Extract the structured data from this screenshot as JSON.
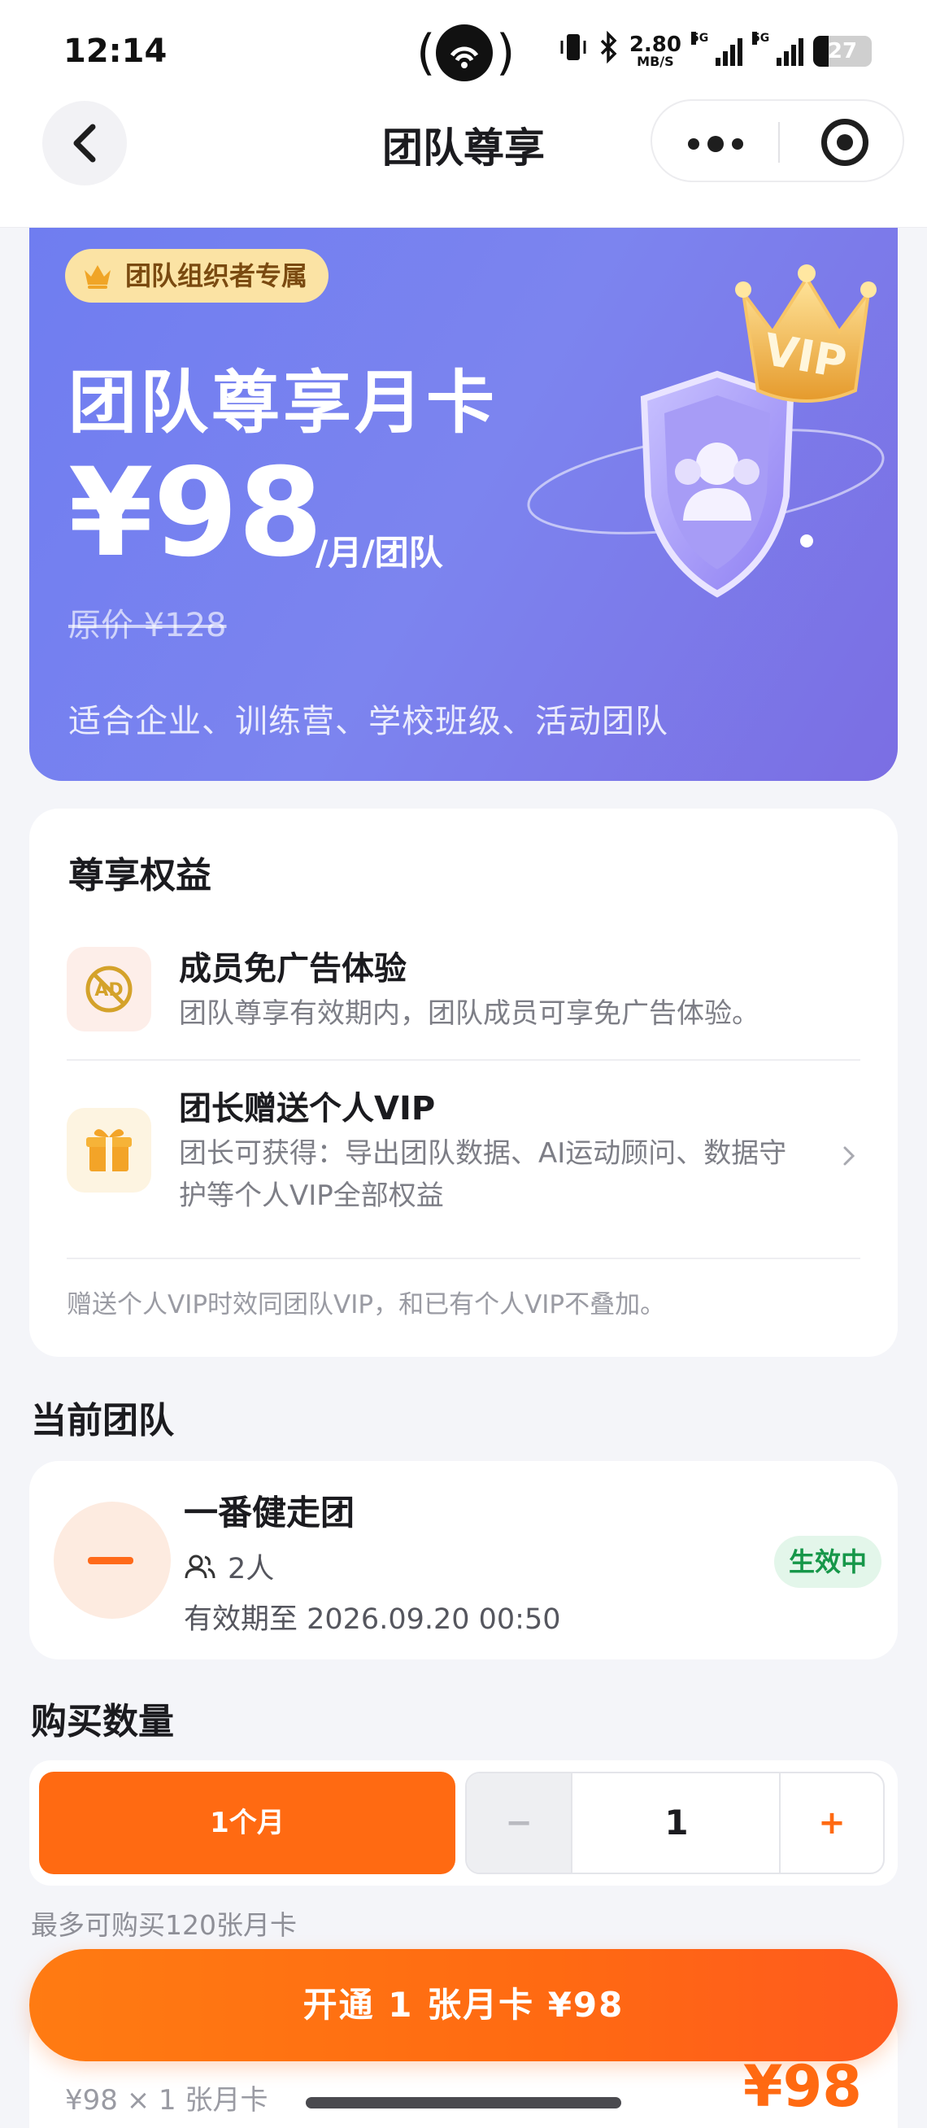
{
  "status_bar": {
    "time": "12:14",
    "net_speed_value": "2.80",
    "net_speed_unit": "MB/S",
    "signal1_label": "5G",
    "signal2_label": "5G",
    "battery_level": "27"
  },
  "header": {
    "title": "团队尊享"
  },
  "hero": {
    "badge": "团队组织者专属",
    "title": "团队尊享月卡",
    "price": "¥98",
    "price_unit": "/月/团队",
    "original_price": "原价 ¥128",
    "description": "适合企业、训练营、学校班级、活动团队",
    "art_label": "VIP"
  },
  "benefits": {
    "section_title": "尊享权益",
    "items": [
      {
        "title": "成员免广告体验",
        "desc": "团队尊享有效期内，团队成员可享免广告体验。",
        "icon": "no-ad-icon"
      },
      {
        "title": "团长赠送个人VIP",
        "desc_line1": "团长可获得：导出团队数据、AI运动顾问、数据守",
        "desc_line2": "护等个人VIP全部权益",
        "icon": "gift-icon"
      }
    ],
    "note": "赠送个人VIP时效同团队VIP，和已有个人VIP不叠加。"
  },
  "team": {
    "section_title": "当前团队",
    "name": "一番健走团",
    "members": "2人",
    "valid_until": "有效期至 2026.09.20 00:50",
    "status": "生效中"
  },
  "purchase": {
    "section_title": "购买数量",
    "period_option": "1个月",
    "minus": "−",
    "quantity": "1",
    "plus": "+",
    "limit_note": "最多可购买120张月卡"
  },
  "summary": {
    "left_text": "¥98 × 1 张月卡",
    "total": "¥98"
  },
  "cta": {
    "label": "开通 1 张月卡 ¥98"
  },
  "colors": {
    "accent": "#ff6a12",
    "hero_gradient_start": "#6f7df0",
    "hero_gradient_end": "#7b6ee3",
    "status_green": "#169749"
  }
}
